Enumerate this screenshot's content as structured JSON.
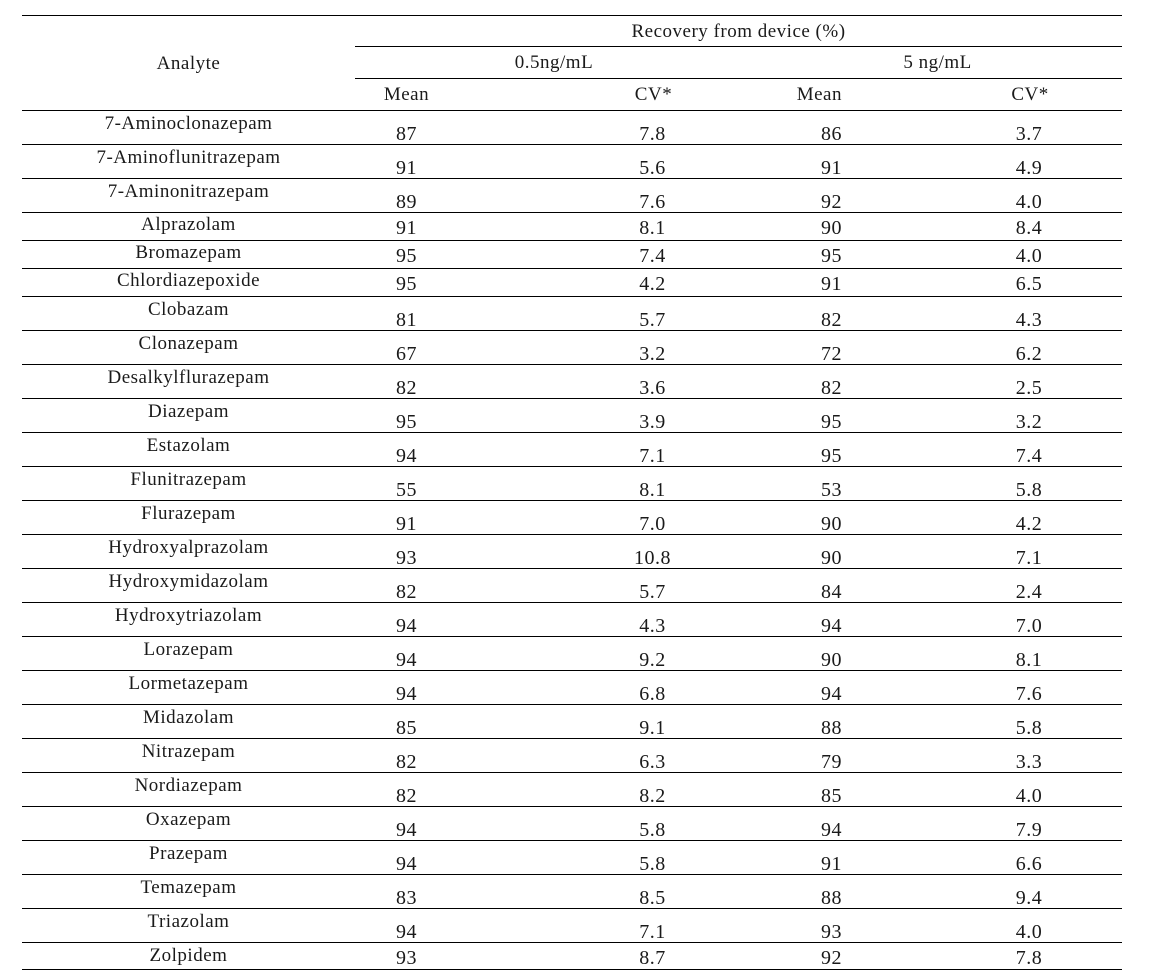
{
  "table": {
    "header": {
      "analyte": "Analyte",
      "group": "Recovery from device (%)",
      "concentrations": [
        "0.5ng/mL",
        "5 ng/mL"
      ],
      "subcolumns": [
        "Mean",
        "CV*",
        "Mean",
        "CV*"
      ]
    },
    "rows": [
      {
        "analyte": "7-Aminoclonazepam",
        "mean_05": "87",
        "cv_05": "7.8",
        "mean_5": "86",
        "cv_5": "3.7"
      },
      {
        "analyte": "7-Aminoflunitrazepam",
        "mean_05": "91",
        "cv_05": "5.6",
        "mean_5": "91",
        "cv_5": "4.9"
      },
      {
        "analyte": "7-Aminonitrazepam",
        "mean_05": "89",
        "cv_05": "7.6",
        "mean_5": "92",
        "cv_5": "4.0"
      },
      {
        "analyte": "Alprazolam",
        "mean_05": "91",
        "cv_05": "8.1",
        "mean_5": "90",
        "cv_5": "8.4"
      },
      {
        "analyte": "Bromazepam",
        "mean_05": "95",
        "cv_05": "7.4",
        "mean_5": "95",
        "cv_5": "4.0"
      },
      {
        "analyte": "Chlordiazepoxide",
        "mean_05": "95",
        "cv_05": "4.2",
        "mean_5": "91",
        "cv_5": "6.5"
      },
      {
        "analyte": "Clobazam",
        "mean_05": "81",
        "cv_05": "5.7",
        "mean_5": "82",
        "cv_5": "4.3"
      },
      {
        "analyte": "Clonazepam",
        "mean_05": "67",
        "cv_05": "3.2",
        "mean_5": "72",
        "cv_5": "6.2"
      },
      {
        "analyte": "Desalkylflurazepam",
        "mean_05": "82",
        "cv_05": "3.6",
        "mean_5": "82",
        "cv_5": "2.5"
      },
      {
        "analyte": "Diazepam",
        "mean_05": "95",
        "cv_05": "3.9",
        "mean_5": "95",
        "cv_5": "3.2"
      },
      {
        "analyte": "Estazolam",
        "mean_05": "94",
        "cv_05": "7.1",
        "mean_5": "95",
        "cv_5": "7.4"
      },
      {
        "analyte": "Flunitrazepam",
        "mean_05": "55",
        "cv_05": "8.1",
        "mean_5": "53",
        "cv_5": "5.8"
      },
      {
        "analyte": "Flurazepam",
        "mean_05": "91",
        "cv_05": "7.0",
        "mean_5": "90",
        "cv_5": "4.2"
      },
      {
        "analyte": "Hydroxyalprazolam",
        "mean_05": "93",
        "cv_05": "10.8",
        "mean_5": "90",
        "cv_5": "7.1"
      },
      {
        "analyte": "Hydroxymidazolam",
        "mean_05": "82",
        "cv_05": "5.7",
        "mean_5": "84",
        "cv_5": "2.4"
      },
      {
        "analyte": "Hydroxytriazolam",
        "mean_05": "94",
        "cv_05": "4.3",
        "mean_5": "94",
        "cv_5": "7.0"
      },
      {
        "analyte": "Lorazepam",
        "mean_05": "94",
        "cv_05": "9.2",
        "mean_5": "90",
        "cv_5": "8.1"
      },
      {
        "analyte": "Lormetazepam",
        "mean_05": "94",
        "cv_05": "6.8",
        "mean_5": "94",
        "cv_5": "7.6"
      },
      {
        "analyte": "Midazolam",
        "mean_05": "85",
        "cv_05": "9.1",
        "mean_5": "88",
        "cv_5": "5.8"
      },
      {
        "analyte": "Nitrazepam",
        "mean_05": "82",
        "cv_05": "6.3",
        "mean_5": "79",
        "cv_5": "3.3"
      },
      {
        "analyte": "Nordiazepam",
        "mean_05": "82",
        "cv_05": "8.2",
        "mean_5": "85",
        "cv_5": "4.0"
      },
      {
        "analyte": "Oxazepam",
        "mean_05": "94",
        "cv_05": "5.8",
        "mean_5": "94",
        "cv_5": "7.9"
      },
      {
        "analyte": "Prazepam",
        "mean_05": "94",
        "cv_05": "5.8",
        "mean_5": "91",
        "cv_5": "6.6"
      },
      {
        "analyte": "Temazepam",
        "mean_05": "83",
        "cv_05": "8.5",
        "mean_5": "88",
        "cv_5": "9.4"
      },
      {
        "analyte": "Triazolam",
        "mean_05": "94",
        "cv_05": "7.1",
        "mean_5": "93",
        "cv_5": "4.0"
      },
      {
        "analyte": "Zolpidem",
        "mean_05": "93",
        "cv_05": "8.7",
        "mean_5": "92",
        "cv_5": "7.8"
      }
    ]
  }
}
